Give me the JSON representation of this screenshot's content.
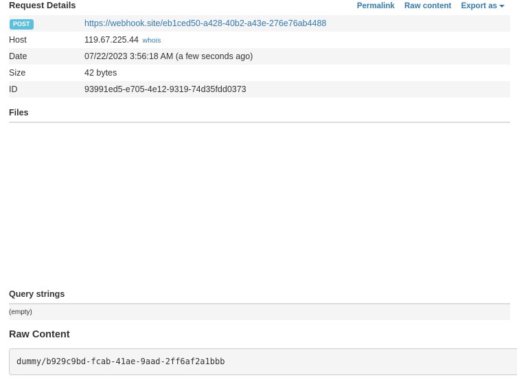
{
  "request_details": {
    "title": "Request Details",
    "actions": {
      "permalink": "Permalink",
      "raw_content": "Raw content",
      "export_as": "Export as"
    },
    "method_badge": "POST",
    "url": "https://webhook.site/eb1ced50-a428-40b2-a43e-276e76ab4488",
    "host": {
      "label": "Host",
      "value": "119.67.225.44",
      "whois": "whois"
    },
    "date": {
      "label": "Date",
      "value": "07/22/2023 3:56:18 AM (a few seconds ago)"
    },
    "size": {
      "label": "Size",
      "value": "42 bytes"
    },
    "id": {
      "label": "ID",
      "value": "93991ed5-e705-4e12-9319-74d35fdd0373"
    }
  },
  "files": {
    "title": "Files"
  },
  "query_strings": {
    "title": "Query strings",
    "empty": "(empty)"
  },
  "raw_content": {
    "title": "Raw Content",
    "body": "dummy/b929c9bd-fcab-41ae-9aad-2ff6af2a1bbb"
  },
  "colors": {
    "link": "#337ab7",
    "badge": "#5bc0de",
    "stripe": "#f5f5f5",
    "rule": "#dddddd"
  },
  "icons": {
    "export_dropdown": "caret-down-icon"
  }
}
